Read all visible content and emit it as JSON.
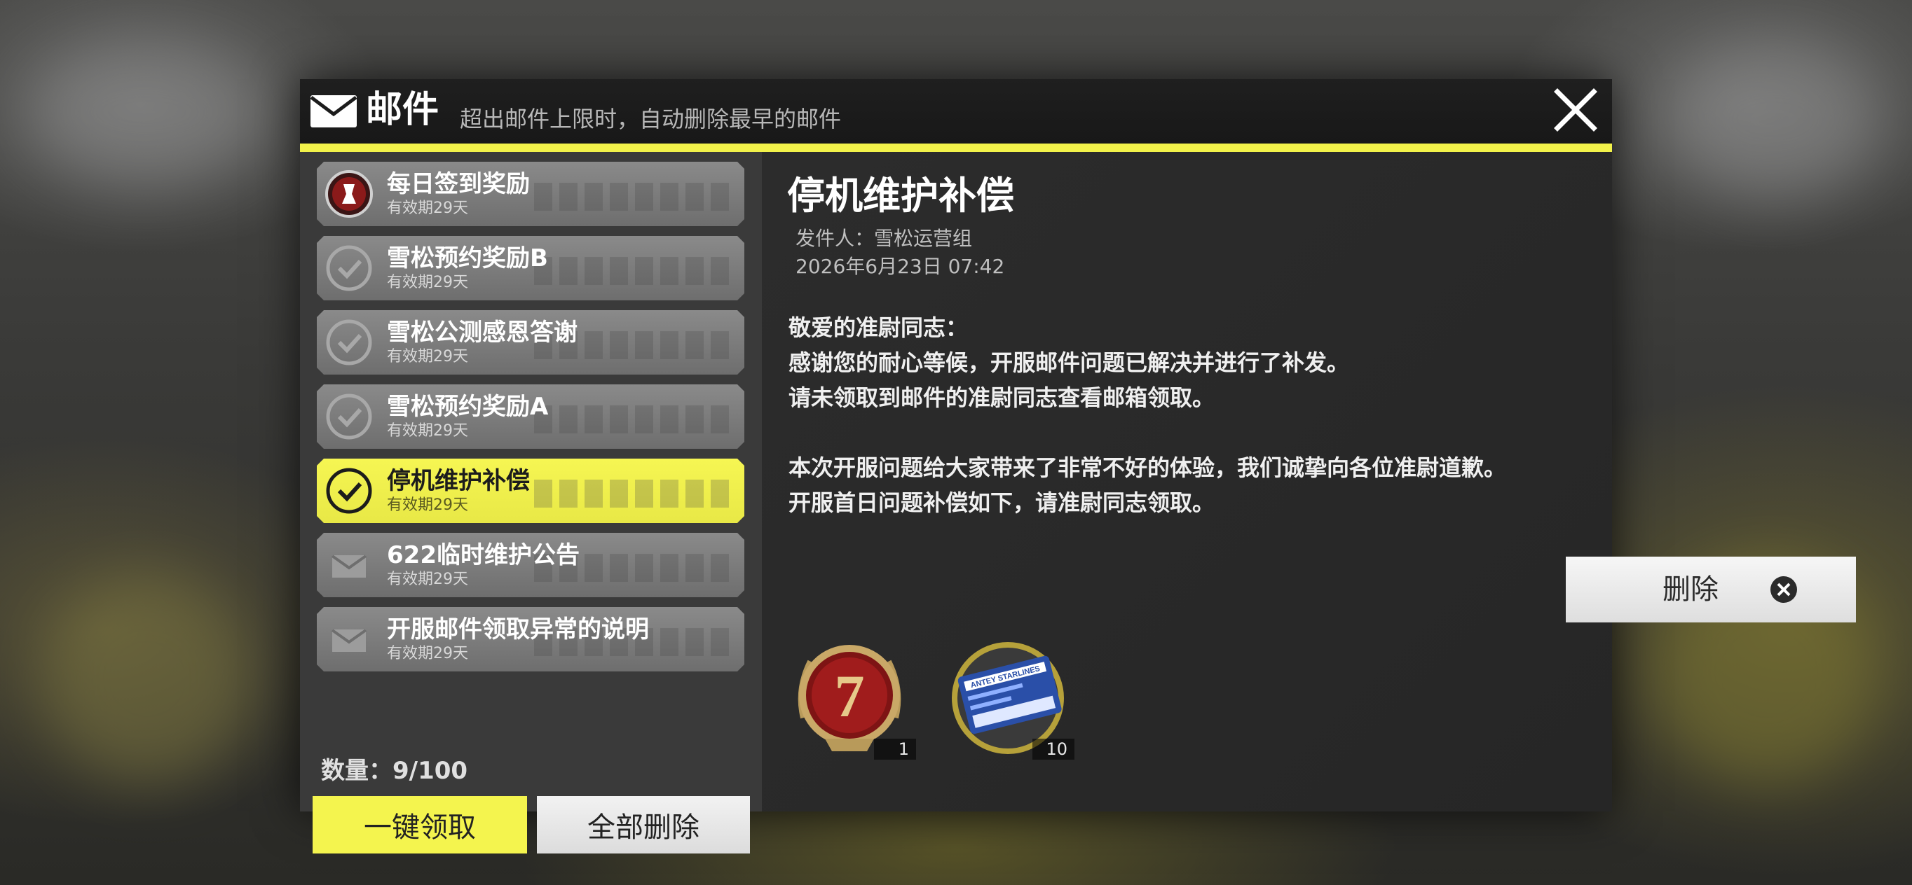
{
  "header": {
    "title": "邮件",
    "subtitle": "超出邮件上限时，自动删除最早的邮件"
  },
  "mail_list": [
    {
      "title": "每日签到奖励",
      "expiry": "有效期29天",
      "icon": "daily-checkin-icon",
      "selected": false
    },
    {
      "title": "雪松预约奖励B",
      "expiry": "有效期29天",
      "icon": "checkmark-icon",
      "selected": false
    },
    {
      "title": "雪松公测感恩答谢",
      "expiry": "有效期29天",
      "icon": "checkmark-icon",
      "selected": false
    },
    {
      "title": "雪松预约奖励A",
      "expiry": "有效期29天",
      "icon": "checkmark-icon",
      "selected": false
    },
    {
      "title": "停机维护补偿",
      "expiry": "有效期29天",
      "icon": "checkmark-icon",
      "selected": true
    },
    {
      "title": "622临时维护公告",
      "expiry": "有效期29天",
      "icon": "envelope-icon",
      "selected": false
    },
    {
      "title": "开服邮件领取异常的说明",
      "expiry": "有效期29天",
      "icon": "envelope-icon",
      "selected": false
    }
  ],
  "footer": {
    "count_label": "数量：9/100",
    "claim_all_label": "一键领取",
    "delete_all_label": "全部删除"
  },
  "detail": {
    "title": "停机维护补偿",
    "sender": "发件人：雪松运营组",
    "date": "2026年6月23日  07:42",
    "body": [
      "敬爱的准尉同志：",
      "感谢您的耐心等候，开服邮件问题已解决并进行了补发。",
      "请未领取到邮件的准尉同志查看邮箱领取。",
      "",
      "本次开服问题给大家带来了非常不好的体验，我们诚挚向各位准尉道歉。",
      "开服首日问题补偿如下，请准尉同志领取。"
    ],
    "rewards": [
      {
        "icon": "rank-medal-7-icon",
        "medal_number": "7",
        "quantity": "1"
      },
      {
        "icon": "ticket-card-icon",
        "card_text": "ANTEY STARLINES",
        "quantity": "10"
      }
    ],
    "delete_label": "删除"
  },
  "colors": {
    "accent_yellow": "#f4f44e",
    "dialog_bg": "#2d2d2d",
    "header_bg": "#1c1c1c"
  }
}
